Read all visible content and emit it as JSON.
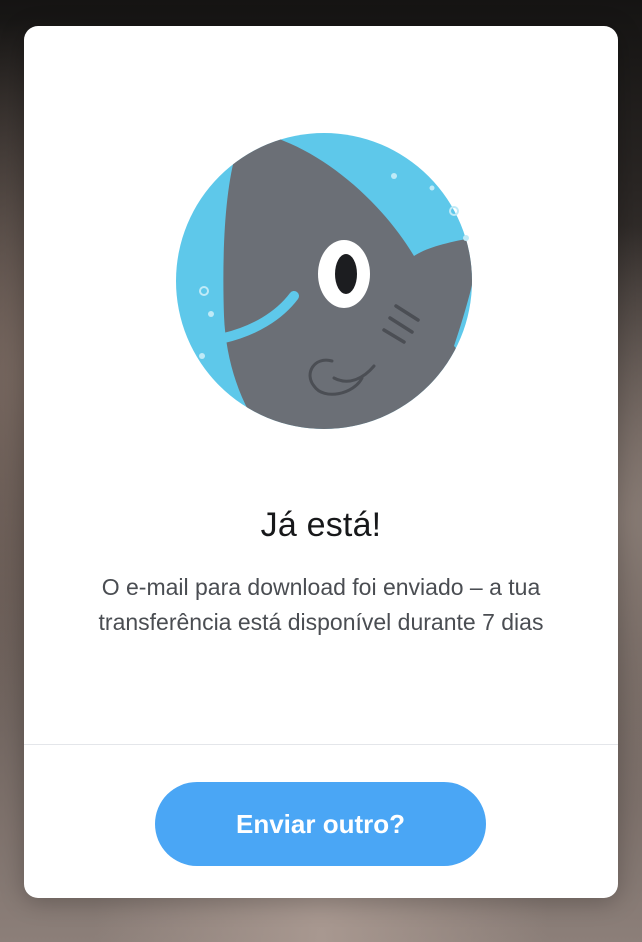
{
  "dialog": {
    "illustration_icon": "shark-mascot-icon",
    "title": "Já está!",
    "message": "O e-mail para download foi enviado – a tua transferência está disponível durante 7 dias",
    "button_label": "Enviar outro?"
  },
  "colors": {
    "accent": "#4aa6f5",
    "circle": "#5ec8ea",
    "shark": "#6b6f76",
    "card": "#ffffff"
  }
}
